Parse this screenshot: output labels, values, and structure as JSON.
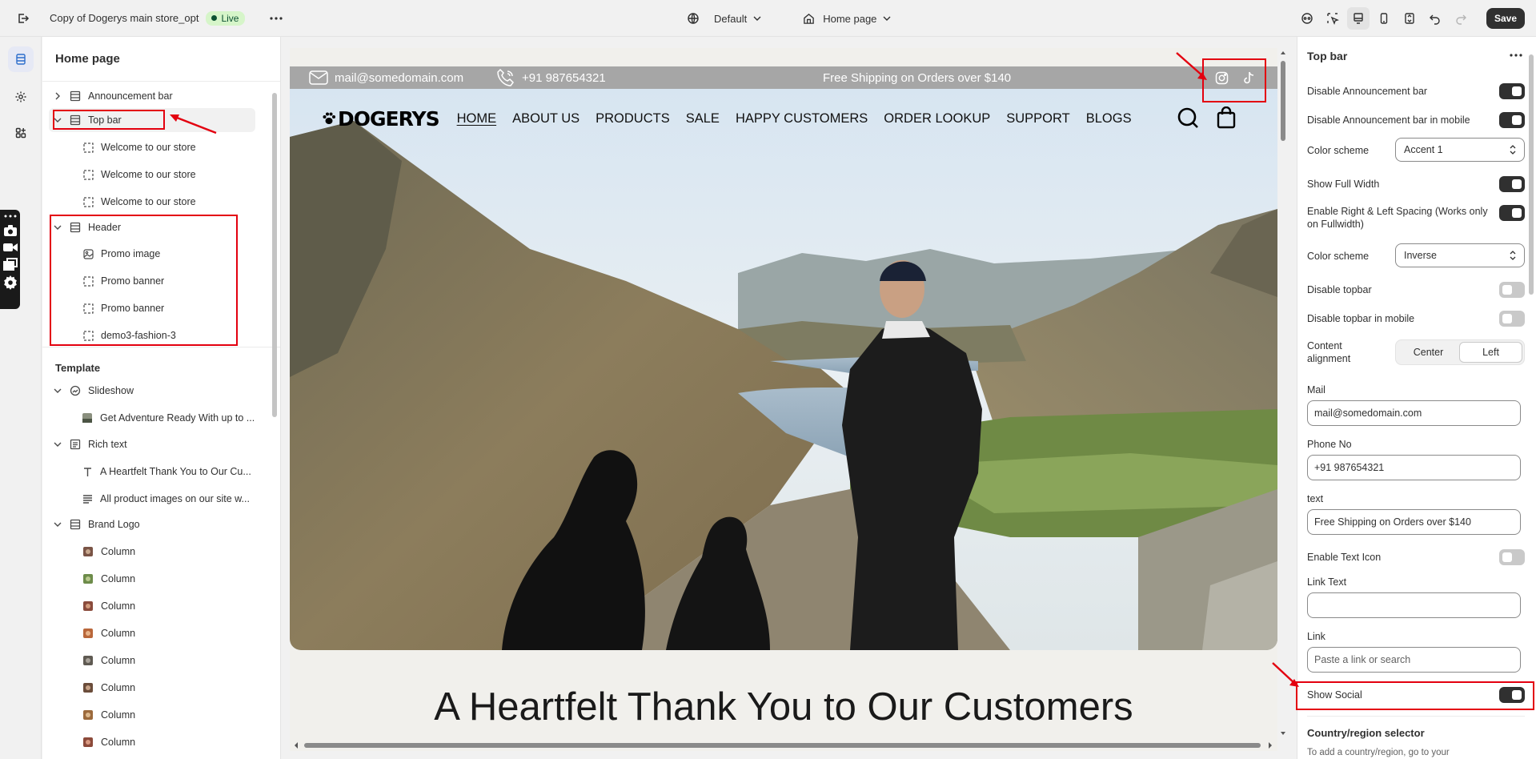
{
  "topbar": {
    "store_name": "Copy of Dogerys main store_opt",
    "live_badge": "Live",
    "theme_selector": "Default",
    "page_selector": "Home page",
    "save_label": "Save"
  },
  "sidebar": {
    "title": "Home page",
    "header_group": [
      {
        "label": "Announcement bar",
        "icon": "section-icon",
        "chevron": "right"
      },
      {
        "label": "Top bar",
        "icon": "section-icon",
        "chevron": "down",
        "selected": true
      },
      {
        "label": "Welcome to our store",
        "icon": "block-icon"
      },
      {
        "label": "Welcome to our store",
        "icon": "block-icon"
      },
      {
        "label": "Welcome to our store",
        "icon": "block-icon"
      },
      {
        "label": "Header",
        "icon": "section-icon",
        "chevron": "down"
      },
      {
        "label": "Promo image",
        "icon": "image-icon"
      },
      {
        "label": "Promo banner",
        "icon": "block-icon"
      },
      {
        "label": "Promo banner",
        "icon": "block-icon"
      },
      {
        "label": "demo3-fashion-3",
        "icon": "block-icon"
      }
    ],
    "template_label": "Template",
    "template_group": [
      {
        "label": "Slideshow",
        "icon": "slideshow-icon",
        "chevron": "down"
      },
      {
        "label": "Get Adventure Ready With up to ...",
        "icon": "thumbnail-icon"
      },
      {
        "label": "Rich text",
        "icon": "richtext-icon",
        "chevron": "down"
      },
      {
        "label": "A Heartfelt Thank You to Our Cu...",
        "icon": "text-type-icon"
      },
      {
        "label": "All product images on our site w...",
        "icon": "paragraph-icon"
      },
      {
        "label": "Brand Logo",
        "icon": "section-icon",
        "chevron": "down"
      },
      {
        "label": "Column",
        "icon": "thumbnail-icon"
      },
      {
        "label": "Column",
        "icon": "thumbnail-icon"
      },
      {
        "label": "Column",
        "icon": "thumbnail-icon"
      },
      {
        "label": "Column",
        "icon": "thumbnail-icon"
      },
      {
        "label": "Column",
        "icon": "thumbnail-icon"
      },
      {
        "label": "Column",
        "icon": "thumbnail-icon"
      },
      {
        "label": "Column",
        "icon": "thumbnail-icon"
      },
      {
        "label": "Column",
        "icon": "thumbnail-icon"
      }
    ]
  },
  "preview": {
    "announcement": {
      "mail": "mail@somedomain.com",
      "phone": "+91 987654321",
      "text": "Free Shipping on Orders over $140"
    },
    "logo": "DOGERYS",
    "menu": [
      "HOME",
      "ABOUT US",
      "PRODUCTS",
      "SALE",
      "HAPPY CUSTOMERS",
      "ORDER LOOKUP",
      "SUPPORT",
      "BLOGS"
    ],
    "heading": "A Heartfelt Thank You to Our Customers"
  },
  "settings": {
    "title": "Top bar",
    "disable_announcement": "Disable Announcement bar",
    "disable_announcement_mobile": "Disable Announcement bar in mobile",
    "color_scheme_label": "Color scheme",
    "color_scheme_1": "Accent 1",
    "show_full_width": "Show Full Width",
    "enable_spacing": "Enable Right & Left Spacing (Works only on Fullwidth)",
    "color_scheme_2": "Inverse",
    "disable_topbar": "Disable topbar",
    "disable_topbar_mobile": "Disable topbar in mobile",
    "content_alignment": "Content alignment",
    "align_center": "Center",
    "align_left": "Left",
    "mail_label": "Mail",
    "mail_value": "mail@somedomain.com",
    "phone_label": "Phone No",
    "phone_value": "+91 987654321",
    "text_label": "text",
    "text_value": "Free Shipping on Orders over $140",
    "enable_text_icon": "Enable Text Icon",
    "link_text_label": "Link Text",
    "link_text_value": "",
    "link_label": "Link",
    "link_placeholder": "Paste a link or search",
    "show_social": "Show Social",
    "country_heading": "Country/region selector",
    "country_desc": "To add a country/region, go to your"
  },
  "colors": {
    "annotation_red": "#e3000f",
    "announcement_bg": "#a6a6a6",
    "live_badge_bg": "#d6f5c9"
  }
}
